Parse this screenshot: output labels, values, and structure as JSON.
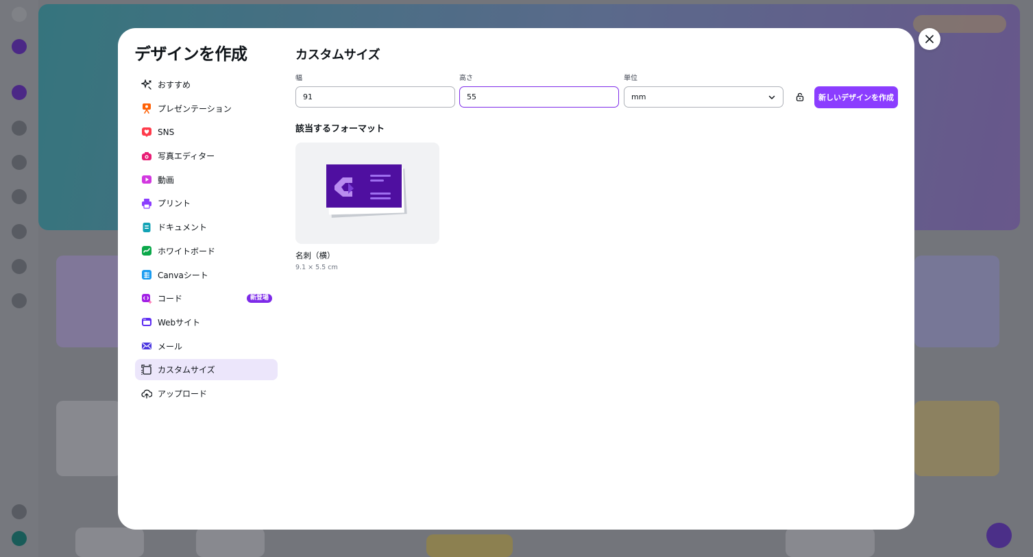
{
  "modal": {
    "title": "デザインを作成",
    "close_icon": "close-icon"
  },
  "nav": {
    "items": [
      {
        "label": "おすすめ",
        "icon": "sparkle-icon",
        "color": "#0e1318"
      },
      {
        "label": "プレゼンテーション",
        "icon": "presentation-icon",
        "color": "#ff6105"
      },
      {
        "label": "SNS",
        "icon": "heart-icon",
        "color": "#ff3b4b"
      },
      {
        "label": "写真エディター",
        "icon": "camera-icon",
        "color": "#e81d75"
      },
      {
        "label": "動画",
        "icon": "video-icon",
        "color": "#d238e0"
      },
      {
        "label": "プリント",
        "icon": "printer-icon",
        "color": "#8b3dff"
      },
      {
        "label": "ドキュメント",
        "icon": "document-icon",
        "color": "#13a3b5"
      },
      {
        "label": "ホワイトボード",
        "icon": "whiteboard-icon",
        "color": "#0ba84a"
      },
      {
        "label": "Canvaシート",
        "icon": "sheet-icon",
        "color": "#1b9cf0"
      },
      {
        "label": "コード",
        "icon": "code-icon",
        "color": "#a11ee5",
        "badge": "新登場"
      },
      {
        "label": "Webサイト",
        "icon": "website-icon",
        "color": "#5d2cf2"
      },
      {
        "label": "メール",
        "icon": "mail-icon",
        "color": "#4a36e0"
      },
      {
        "label": "カスタムサイズ",
        "icon": "custom-size-icon",
        "color": "#0e1318",
        "active": true
      },
      {
        "label": "アップロード",
        "icon": "upload-cloud-icon",
        "color": "#0e1318"
      }
    ]
  },
  "custom": {
    "title": "カスタムサイズ",
    "width_label": "幅",
    "width_value": "91",
    "height_label": "高さ",
    "height_value": "55",
    "unit_label": "単位",
    "unit_value": "mm",
    "create_button": "新しいデザインを作成"
  },
  "formats": {
    "title": "該当するフォーマット",
    "items": [
      {
        "name": "名刺（横）",
        "size": "9.1 × 5.5 cm",
        "thumb_color": "#4f0fa0"
      }
    ]
  },
  "colors": {
    "accent": "#8b3dff",
    "active_nav_bg": "#ece6fb"
  }
}
